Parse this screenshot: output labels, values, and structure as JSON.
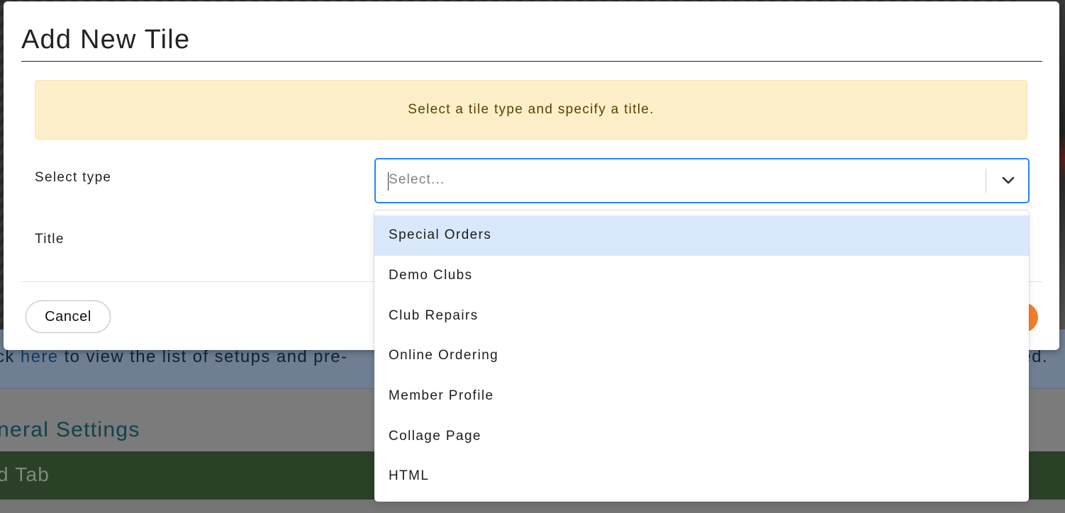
{
  "background": {
    "info_text_prefix": "ck ",
    "info_link": "here",
    "info_text_suffix": " to view the list of setups and pre-",
    "info_text_right": "ed.",
    "section_title": "neral Settings",
    "tab_label": "d Tab"
  },
  "modal": {
    "title": "Add New Tile",
    "alert": "Select a tile type and specify a title.",
    "fields": {
      "type_label": "Select type",
      "title_label": "Title"
    },
    "select": {
      "placeholder": "Select...",
      "open": true,
      "options": [
        {
          "label": "Special Orders",
          "focused": true
        },
        {
          "label": "Demo Clubs",
          "focused": false
        },
        {
          "label": "Club Repairs",
          "focused": false
        },
        {
          "label": "Online Ordering",
          "focused": false
        },
        {
          "label": "Member Profile",
          "focused": false
        },
        {
          "label": "Collage Page",
          "focused": false
        },
        {
          "label": "HTML",
          "focused": false
        }
      ]
    },
    "footer": {
      "cancel_label": "Cancel"
    }
  },
  "colors": {
    "focus_border": "#2684ff",
    "option_focused_bg": "#d9e8fc",
    "alert_bg": "#fdefc9",
    "primary_button": "#f47d2a"
  },
  "icons": {
    "select_indicator": "chevron-down-icon"
  }
}
